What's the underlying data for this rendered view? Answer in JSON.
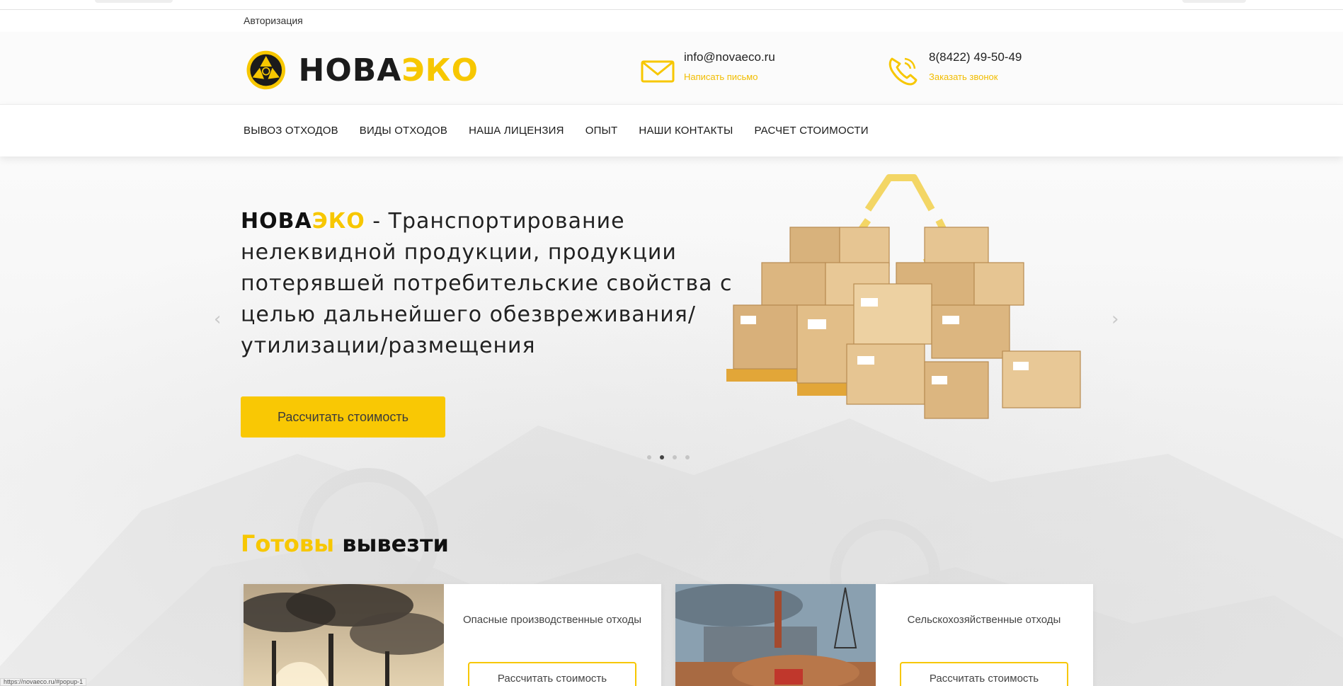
{
  "top": {
    "auth_label": "Авторизация"
  },
  "header": {
    "logo": {
      "part1": "НОВА",
      "part2": "ЭКО"
    },
    "email": {
      "value": "info@novaeco.ru",
      "action": "Написать письмо"
    },
    "phone": {
      "value": "8(8422) 49-50-49",
      "action": "Заказать звонок"
    }
  },
  "nav": {
    "items": [
      {
        "label": "ВЫВОЗ ОТХОДОВ"
      },
      {
        "label": "ВИДЫ ОТХОДОВ"
      },
      {
        "label": "НАША ЛИЦЕНЗИЯ"
      },
      {
        "label": "ОПЫТ"
      },
      {
        "label": "НАШИ КОНТАКТЫ"
      },
      {
        "label": "РАСЧЕТ СТОИМОСТИ"
      }
    ]
  },
  "hero": {
    "brand1": "НОВА",
    "brand2": "ЭКО",
    "text": " - Транспортирование нелеквидной продукции, продукции потерявшей потребительские свойства с целью дальнейшего обезвреживания/утилизации/размещения",
    "cta": "Рассчитать стоимость",
    "prev_arrow": "‹",
    "next_arrow": "›",
    "slide_count": 4,
    "active_slide": 2
  },
  "section": {
    "title_accent": "Готовы",
    "title_rest": " вывезти",
    "cards": [
      {
        "name": "Опасные производственные отходы",
        "button": "Рассчитать стоимость"
      },
      {
        "name": "Сельскохозяйственные отходы",
        "button": "Рассчитать стоимость"
      }
    ]
  },
  "status_bar": {
    "url": "https://novaeco.ru/#popup-1"
  },
  "colors": {
    "accent": "#f7c700",
    "button": "#f9c804",
    "text": "#222222"
  }
}
